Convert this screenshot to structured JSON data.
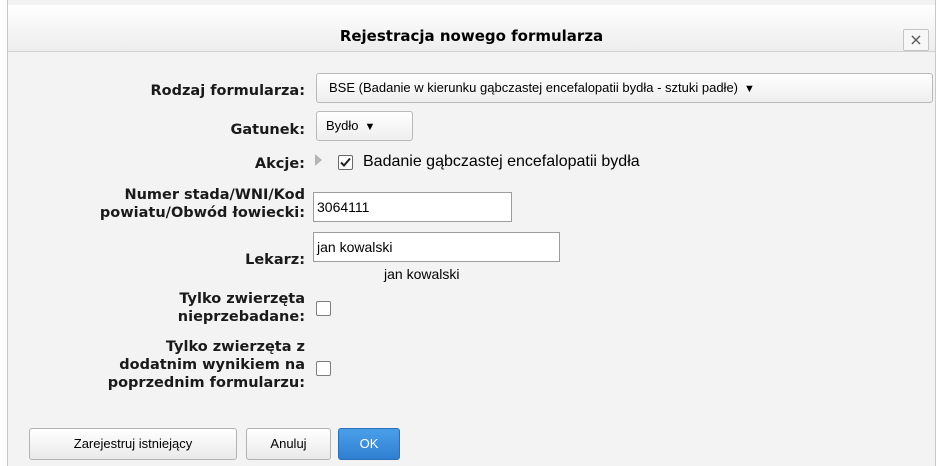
{
  "dialog": {
    "title": "Rejestracja nowego formularza",
    "close_glyph": "×"
  },
  "form": {
    "rodzaj_label": "Rodzaj formularza:",
    "rodzaj_value": "BSE   (Badanie w kierunku gąbczastej encefalopatii bydła - sztuki padłe)",
    "gatunek_label": "Gatunek:",
    "gatunek_value": "Bydło",
    "akcje_label": "Akcje:",
    "akcje_item_label": "Badanie gąbczastej encefalopatii bydła",
    "akcje_item_checked": true,
    "numer_label_line1": "Numer stada/WNI/Kod",
    "numer_label_line2": "powiatu/Obwód łowiecki:",
    "numer_value": "3064111",
    "lekarz_label": "Lekarz:",
    "lekarz_value": "jan kowalski",
    "lekarz_suggestion": "jan kowalski",
    "tylko_nieprzebadane_line1": "Tylko zwierzęta",
    "tylko_nieprzebadane_line2": "nieprzebadane:",
    "tylko_nieprzebadane_checked": false,
    "tylko_dodatnie_line1": "Tylko zwierzęta z",
    "tylko_dodatnie_line2": "dodatnim wynikiem na",
    "tylko_dodatnie_line3": "poprzednim formularzu:",
    "tylko_dodatnie_checked": false
  },
  "buttons": {
    "register_existing": "Zarejestruj istniejący",
    "cancel": "Anuluj",
    "ok": "OK"
  },
  "colors": {
    "primary_button": "#3a8ddc",
    "dialog_background": "#f3f3f3"
  }
}
